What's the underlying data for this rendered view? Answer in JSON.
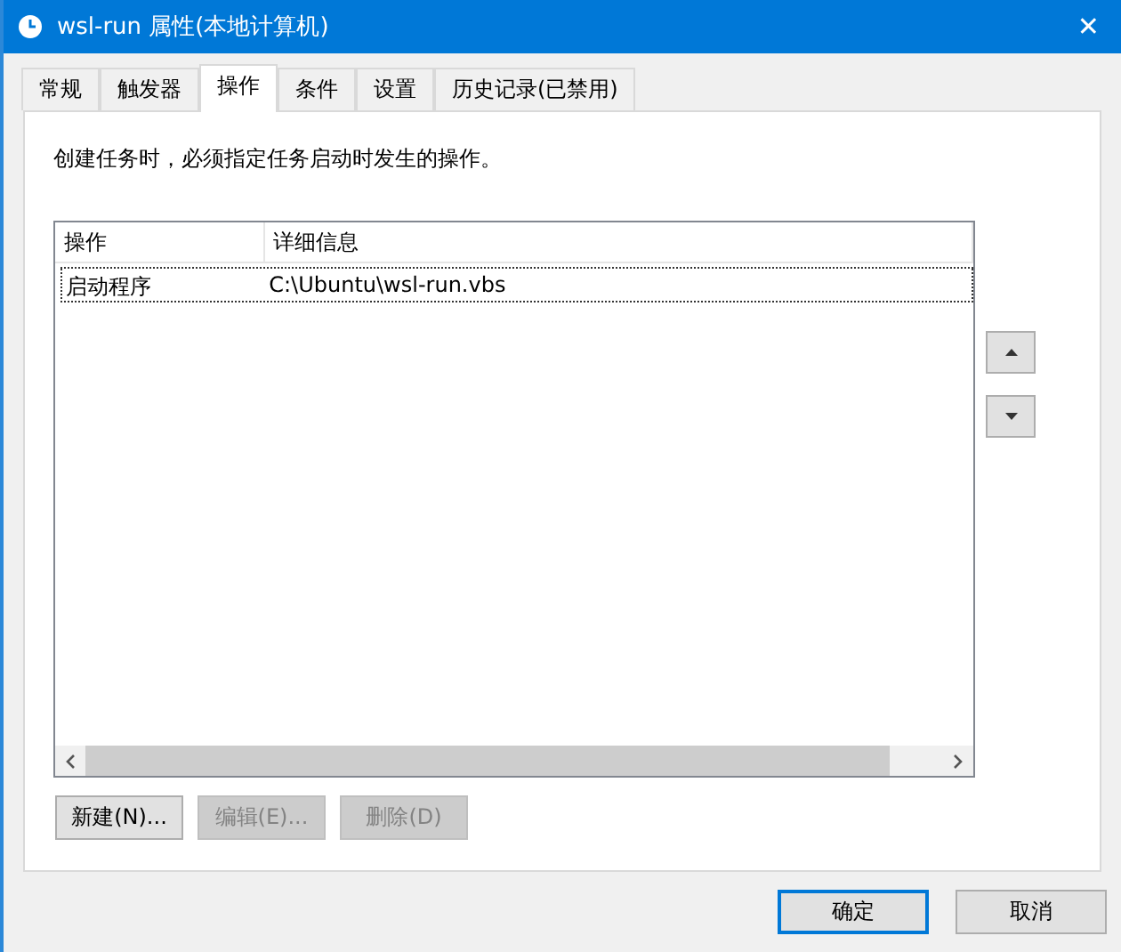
{
  "window": {
    "title": "wsl-run 属性(本地计算机)",
    "close": "✕"
  },
  "tabs": [
    {
      "label": "常规",
      "selected": false
    },
    {
      "label": "触发器",
      "selected": false
    },
    {
      "label": "操作",
      "selected": true
    },
    {
      "label": "条件",
      "selected": false
    },
    {
      "label": "设置",
      "selected": false
    },
    {
      "label": "历史记录(已禁用)",
      "selected": false
    }
  ],
  "description": "创建任务时，必须指定任务启动时发生的操作。",
  "table": {
    "columns": [
      "操作",
      "详细信息"
    ],
    "rows": [
      {
        "cells": [
          "启动程序",
          "C:\\Ubuntu\\wsl-run.vbs"
        ],
        "selected": true
      }
    ]
  },
  "side_buttons": [
    {
      "kind": "up"
    },
    {
      "kind": "down"
    }
  ],
  "actions": [
    {
      "label": "新建(N)...",
      "disabled": false
    },
    {
      "label": "编辑(E)...",
      "disabled": true
    },
    {
      "label": "删除(D)",
      "disabled": true
    }
  ],
  "footer": [
    {
      "label": "确定",
      "default": true
    },
    {
      "label": "取消",
      "default": false
    }
  ]
}
